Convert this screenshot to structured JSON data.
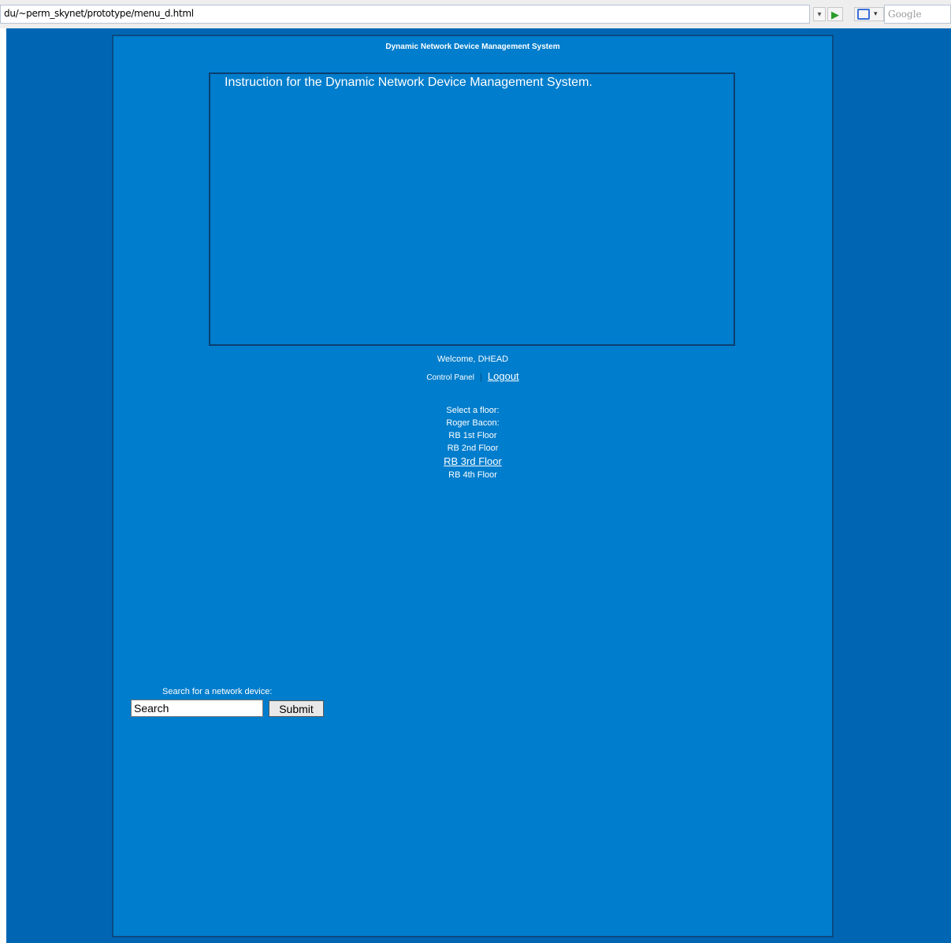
{
  "browser": {
    "url": "du/~perm_skynet/prototype/menu_d.html",
    "dropdown_glyph": "▾",
    "go_glyph": "▶",
    "search_engine_placeholder": "Google"
  },
  "page": {
    "title": "Dynamic Network Device Management System",
    "instructions": "Instruction for the Dynamic Network Device Management System.",
    "welcome": "Welcome, DHEAD",
    "control_panel": "Control Panel",
    "separator": "|",
    "logout": "Logout",
    "floor_prompt": "Select a floor:",
    "building": "Roger Bacon:",
    "floors": [
      "RB 1st Floor",
      "RB 2nd Floor",
      "RB 3rd Floor",
      "RB 4th Floor"
    ],
    "search_label": "Search for a network device:",
    "search_value": "Search",
    "submit_label": "Submit"
  },
  "colors": {
    "outer_background": "#0066b3",
    "panel_background": "#007dcc",
    "border": "#0a4a82"
  }
}
